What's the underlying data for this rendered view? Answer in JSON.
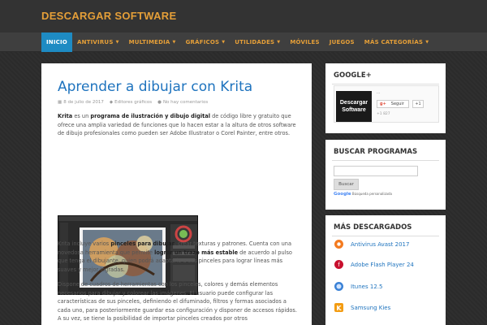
{
  "site": {
    "title": "DESCARGAR SOFTWARE"
  },
  "nav": {
    "items": [
      {
        "label": "INICIO",
        "has_caret": false
      },
      {
        "label": "ANTIVIRUS",
        "has_caret": true
      },
      {
        "label": "MULTIMEDIA",
        "has_caret": true
      },
      {
        "label": "GRÁFICOS",
        "has_caret": true
      },
      {
        "label": "UTILIDADES",
        "has_caret": true
      },
      {
        "label": "MÓVILES",
        "has_caret": false
      },
      {
        "label": "JUEGOS",
        "has_caret": false
      },
      {
        "label": "MÁS CATEGORÍAS",
        "has_caret": true
      }
    ]
  },
  "post": {
    "title": "Aprender a dibujar con Krita",
    "date": "8 de julio de 2017",
    "category": "Editores gráficos",
    "comments": "No hay comentarios",
    "p1": {
      "b1": "Krita",
      "t1": " es un ",
      "b2": "programa de ilustración y dibujo digital",
      "t2": " de código libre y gratuito que ofrece una amplia variedad de funciones que lo hacen estar a la altura de otros software de dibujo profesionales como pueden ser Adobe Illustrator o Corel Painter, entre otros."
    },
    "p2": {
      "t1": "Krita incluye varios ",
      "b1": "pinceles para dibujar",
      "t2": ", crear texturas y patrones. Cuenta con una novedosa herramienta que permite ",
      "b2": "lograr un trazo más estable",
      "t3": " de acuerdo al pulso que tenga el dibujante, quien podrá adaptarlo a sus pinceles para lograr líneas más suaves y mejor logradas."
    },
    "p3": "Dispone de cuadros de herramientas con los pinceles, colores y demás elementos necesarios para dibujar y colorear las imágenes. El usuario puede configurar las características de sus pinceles, definiendo el difuminado, filtros y formas asociados a cada uno, para posteriormente guardar esa configuración y disponer de accesos rápidos. A su vez, se tiene la posibilidad de importar pinceles creados por otros"
  },
  "sidebar": {
    "google": {
      "title": "GOOGLE+",
      "logo_line1": "Descargar",
      "logo_line2": "Software",
      "name": "...",
      "follow": "Seguir",
      "count": "+1",
      "followers": "+1 827"
    },
    "search": {
      "title": "BUSCAR PROGRAMAS",
      "button": "Buscar",
      "powered_brand": "Google",
      "powered_text": "Búsqueda personalizada"
    },
    "downloads": {
      "title": "MÁS DESCARGADOS",
      "items": [
        {
          "label": "Antivirus Avast 2017",
          "icon": "avast-icon",
          "color": "#f47b20"
        },
        {
          "label": "Adobe Flash Player 24",
          "icon": "flash-player-icon",
          "color": "#c8102e"
        },
        {
          "label": "Itunes 12.5",
          "icon": "itunes-icon",
          "color": "#3b82d6"
        },
        {
          "label": "Samsung Kies",
          "icon": "samsung-kies-icon",
          "color": "#f39c12"
        }
      ]
    }
  }
}
